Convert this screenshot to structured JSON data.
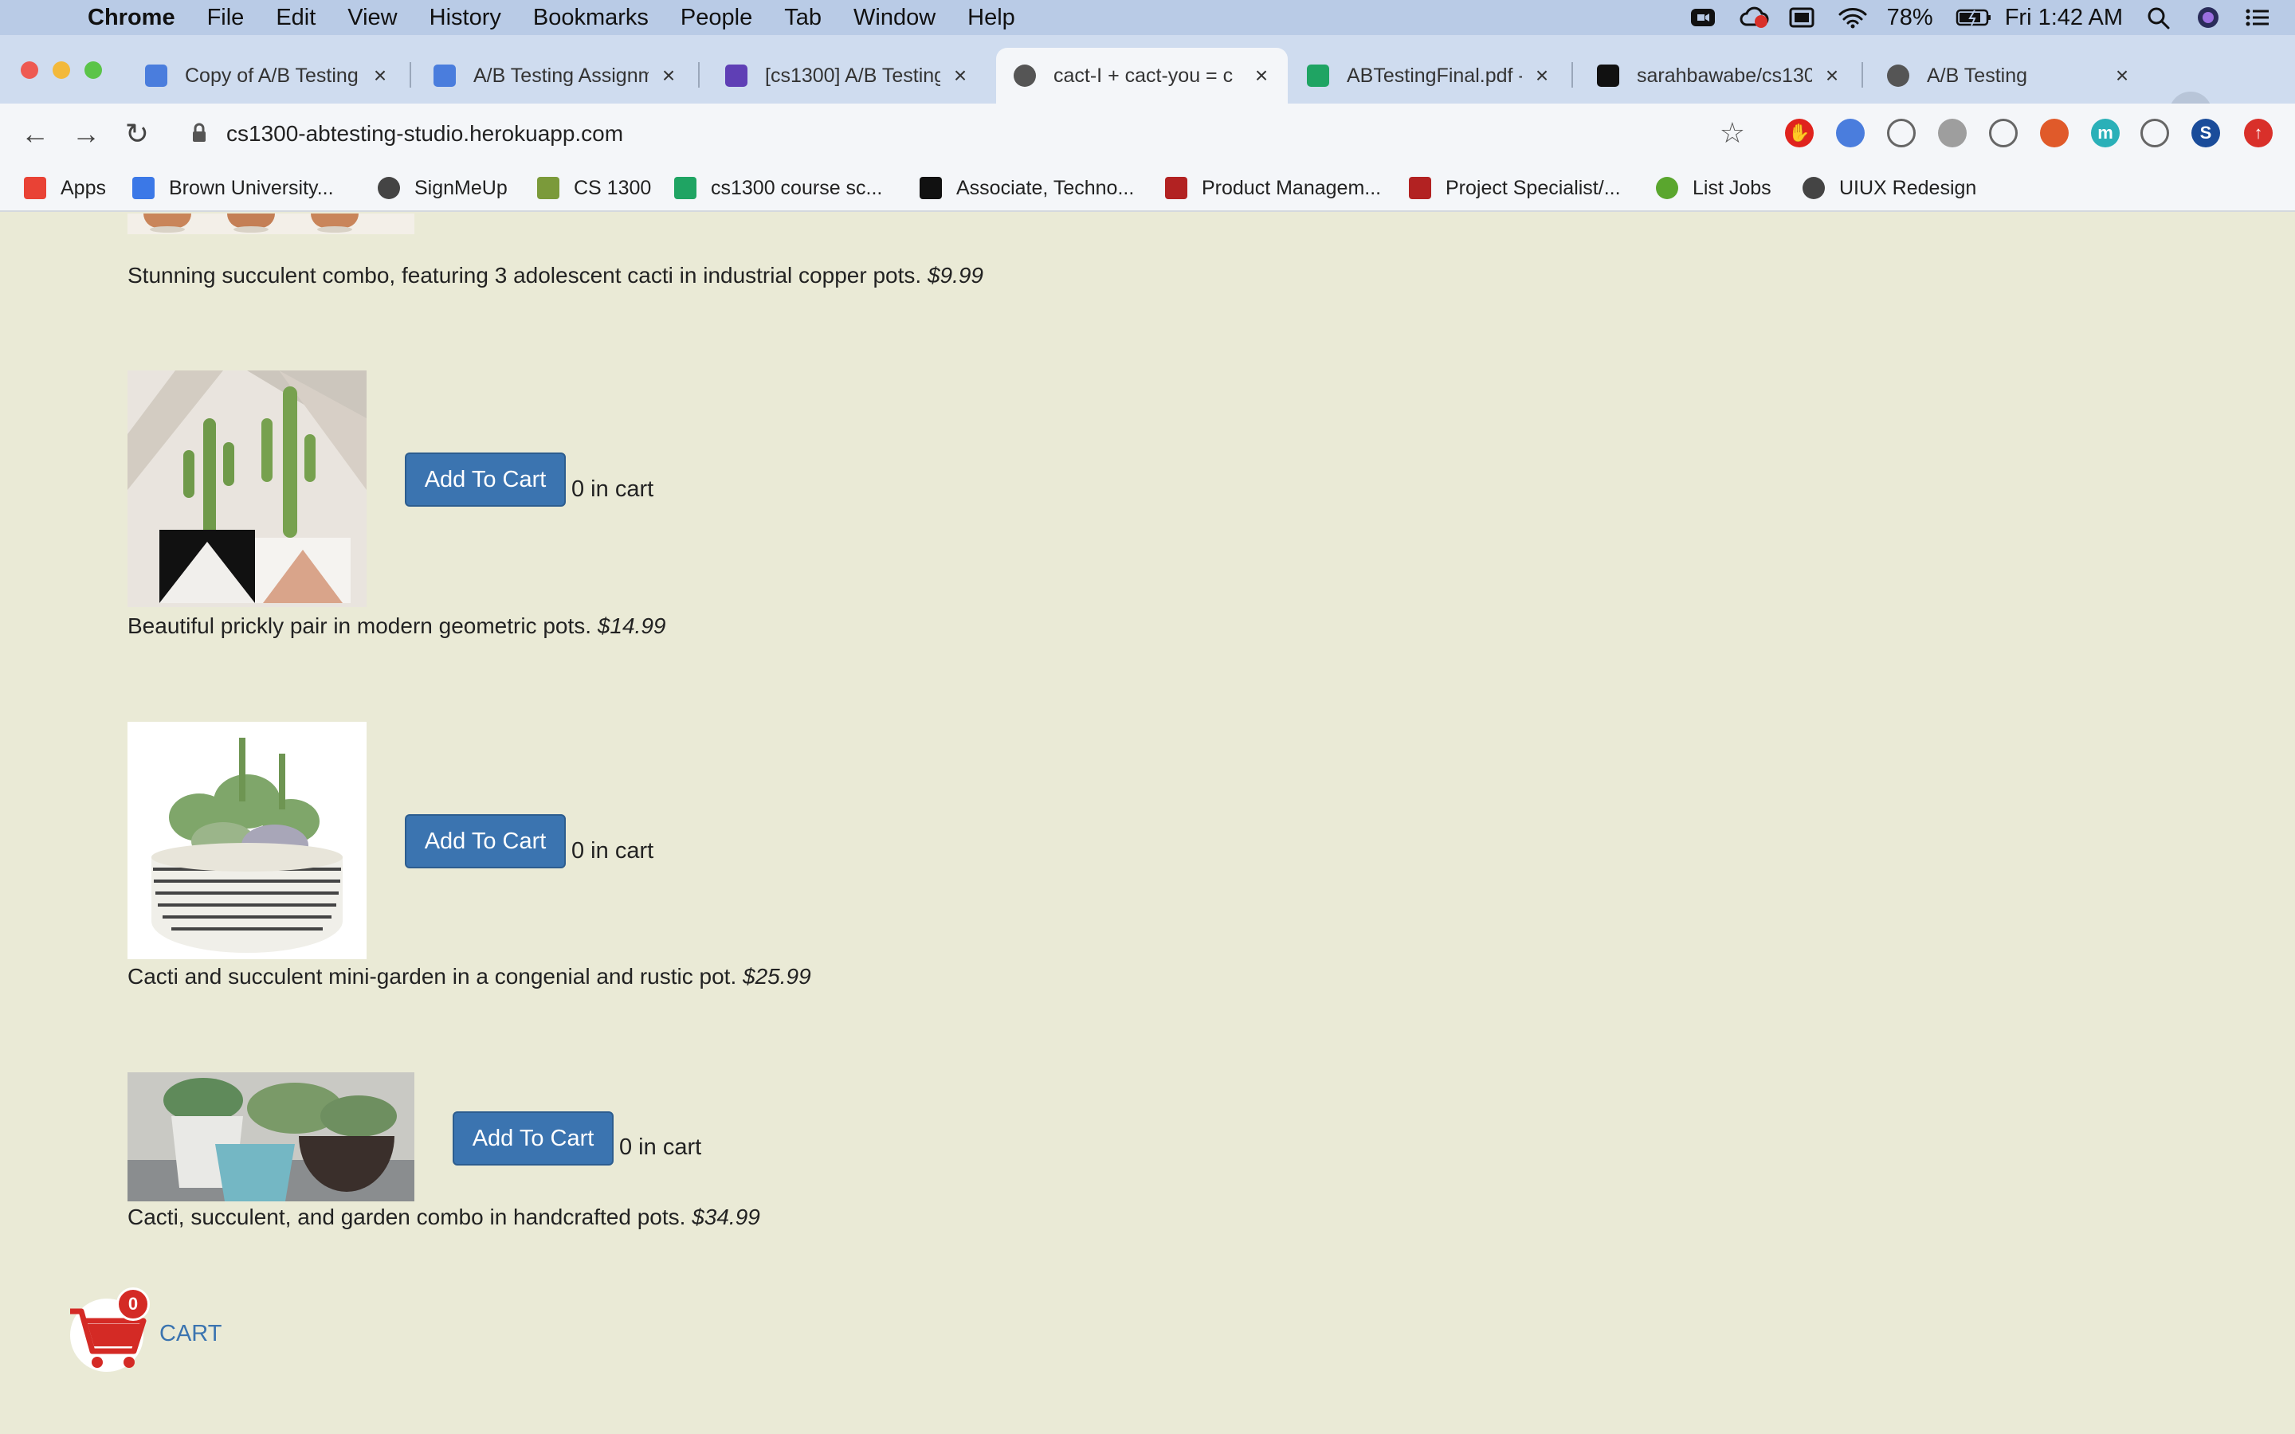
{
  "menubar": {
    "app": "Chrome",
    "items": [
      "File",
      "Edit",
      "View",
      "History",
      "Bookmarks",
      "People",
      "Tab",
      "Window",
      "Help"
    ],
    "battery": "78%",
    "clock": "Fri 1:42 AM"
  },
  "tabs": [
    {
      "title": "Copy of A/B Testing",
      "icon": "google-docs-icon",
      "color": "#4a7ddd"
    },
    {
      "title": "A/B Testing Assignm",
      "icon": "google-docs-icon",
      "color": "#4a7ddd"
    },
    {
      "title": "[cs1300] A/B Testing",
      "icon": "edstem-icon",
      "color": "#5f3fb5"
    },
    {
      "title": "cact-I + cact-you = c",
      "icon": "globe-icon",
      "color": "#555555",
      "active": true
    },
    {
      "title": "ABTestingFinal.pdf -",
      "icon": "google-drive-icon",
      "color": "#1fa463"
    },
    {
      "title": "sarahbawabe/cs1300",
      "icon": "github-icon",
      "color": "#111111"
    },
    {
      "title": "A/B Testing",
      "icon": "globe-icon",
      "color": "#555555"
    }
  ],
  "omnibox": {
    "url": "cs1300-abtesting-studio.herokuapp.com"
  },
  "extensions": [
    {
      "name": "adblock-icon",
      "color": "#e0231d",
      "glyph": "✋"
    },
    {
      "name": "calendar-extension-icon",
      "color": "#4a7ddd",
      "glyph": ""
    },
    {
      "name": "rainbow-extension-icon",
      "color": "#f4f6f9",
      "glyph": ""
    },
    {
      "name": "grammar-extension-icon",
      "color": "#9e9e9e",
      "glyph": ""
    },
    {
      "name": "code-extension-icon",
      "color": "#f4f6f9",
      "glyph": ""
    },
    {
      "name": "color-picker-icon",
      "color": "#e05a2a",
      "glyph": ""
    },
    {
      "name": "m-extension-icon",
      "color": "#2ab0b8",
      "glyph": "m"
    },
    {
      "name": "puzzle-extensions-icon",
      "color": "#f4f6f9",
      "glyph": ""
    },
    {
      "name": "profile-avatar-icon",
      "color": "#1a4c9a",
      "glyph": "S"
    },
    {
      "name": "update-icon",
      "color": "#d9302a",
      "glyph": "↑"
    }
  ],
  "bookmarks": [
    {
      "label": "Apps",
      "icon": "apps-grid-icon",
      "color": "#e94235"
    },
    {
      "label": "Brown University...",
      "icon": "calendar-icon",
      "color": "#3b78e7"
    },
    {
      "label": "SignMeUp",
      "icon": "globe-icon",
      "color": "#444444"
    },
    {
      "label": "CS 1300",
      "icon": "cactus-icon",
      "color": "#7b9a3a"
    },
    {
      "label": "cs1300 course sc...",
      "icon": "sheets-icon",
      "color": "#1fa463"
    },
    {
      "label": "Associate, Techno...",
      "icon": "b-logo-icon",
      "color": "#111111"
    },
    {
      "label": "Product Managem...",
      "icon": "cisco-icon",
      "color": "#b22222"
    },
    {
      "label": "Project Specialist/...",
      "icon": "cisco-icon",
      "color": "#b22222"
    },
    {
      "label": "List Jobs",
      "icon": "g-logo-icon",
      "color": "#5aa62e"
    },
    {
      "label": "UIUX Redesign",
      "icon": "globe-icon",
      "color": "#444444"
    }
  ],
  "products": [
    {
      "description": "Stunning succulent combo, featuring 3 adolescent cacti in industrial copper pots.",
      "price": "$9.99"
    },
    {
      "description": "Beautiful prickly pair in modern geometric pots.",
      "price": "$14.99",
      "button": "Add To Cart",
      "count": "0 in cart"
    },
    {
      "description": "Cacti and succulent mini-garden in a congenial and rustic pot.",
      "price": "$25.99",
      "button": "Add To Cart",
      "count": "0 in cart"
    },
    {
      "description": "Cacti, succulent, and garden combo in handcrafted pots.",
      "price": "$34.99",
      "button": "Add To Cart",
      "count": "0 in cart"
    }
  ],
  "cart": {
    "label": "CART",
    "count": "0"
  }
}
